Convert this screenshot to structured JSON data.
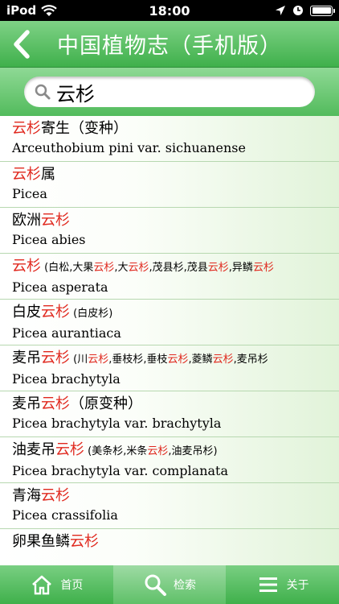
{
  "status_bar": {
    "carrier": "iPod",
    "time": "18:00"
  },
  "nav": {
    "title": "中国植物志（手机版）"
  },
  "search": {
    "value": "云杉"
  },
  "items": [
    {
      "cn": [
        {
          "t": "云杉",
          "hl": true
        },
        {
          "t": "寄生（变种）"
        }
      ],
      "latin": "Arceuthobium pini var. sichuanense"
    },
    {
      "cn": [
        {
          "t": "云杉",
          "hl": true
        },
        {
          "t": "属"
        }
      ],
      "latin": "Picea"
    },
    {
      "cn": [
        {
          "t": "欧洲"
        },
        {
          "t": "云杉",
          "hl": true
        }
      ],
      "latin": "Picea abies"
    },
    {
      "cn": [
        {
          "t": "云杉",
          "hl": true
        },
        {
          "t": " (白松,大果",
          "s": true
        },
        {
          "t": "云杉",
          "hl": true,
          "s": true
        },
        {
          "t": ",大",
          "s": true
        },
        {
          "t": "云杉",
          "hl": true,
          "s": true
        },
        {
          "t": ",茂县杉,茂县",
          "s": true
        },
        {
          "t": "云杉",
          "hl": true,
          "s": true
        },
        {
          "t": ",异鳞",
          "s": true
        },
        {
          "t": "云杉",
          "hl": true,
          "s": true
        }
      ],
      "latin": "Picea asperata"
    },
    {
      "cn": [
        {
          "t": "白皮"
        },
        {
          "t": "云杉",
          "hl": true
        },
        {
          "t": " (白皮杉)",
          "s": true
        }
      ],
      "latin": "Picea aurantiaca"
    },
    {
      "cn": [
        {
          "t": "麦吊"
        },
        {
          "t": "云杉",
          "hl": true
        },
        {
          "t": " (川",
          "s": true
        },
        {
          "t": "云杉",
          "hl": true,
          "s": true
        },
        {
          "t": ",垂枝杉,垂枝",
          "s": true
        },
        {
          "t": "云杉",
          "hl": true,
          "s": true
        },
        {
          "t": ",菱鳞",
          "s": true
        },
        {
          "t": "云杉",
          "hl": true,
          "s": true
        },
        {
          "t": ",麦吊杉",
          "s": true
        }
      ],
      "latin": "Picea brachytyla"
    },
    {
      "cn": [
        {
          "t": "麦吊"
        },
        {
          "t": "云杉",
          "hl": true
        },
        {
          "t": "（原变种）"
        }
      ],
      "latin": "Picea brachytyla var. brachytyla"
    },
    {
      "cn": [
        {
          "t": "油麦吊"
        },
        {
          "t": "云杉",
          "hl": true
        },
        {
          "t": " (美条杉,米条",
          "s": true
        },
        {
          "t": "云杉",
          "hl": true,
          "s": true
        },
        {
          "t": ",油麦吊杉)",
          "s": true
        }
      ],
      "latin": "Picea brachytyla var. complanata"
    },
    {
      "cn": [
        {
          "t": "青海"
        },
        {
          "t": "云杉",
          "hl": true
        }
      ],
      "latin": "Picea crassifolia"
    },
    {
      "cn": [
        {
          "t": "卵果鱼鳞"
        },
        {
          "t": "云杉",
          "hl": true
        }
      ],
      "latin": ""
    }
  ],
  "tabs": [
    {
      "label": "首页",
      "icon": "home-icon",
      "active": false
    },
    {
      "label": "检索",
      "icon": "search-icon",
      "active": true
    },
    {
      "label": "关于",
      "icon": "list-icon",
      "active": false
    }
  ],
  "colors": {
    "highlight": "#e0281e",
    "nav_green": "#3fb04b"
  }
}
